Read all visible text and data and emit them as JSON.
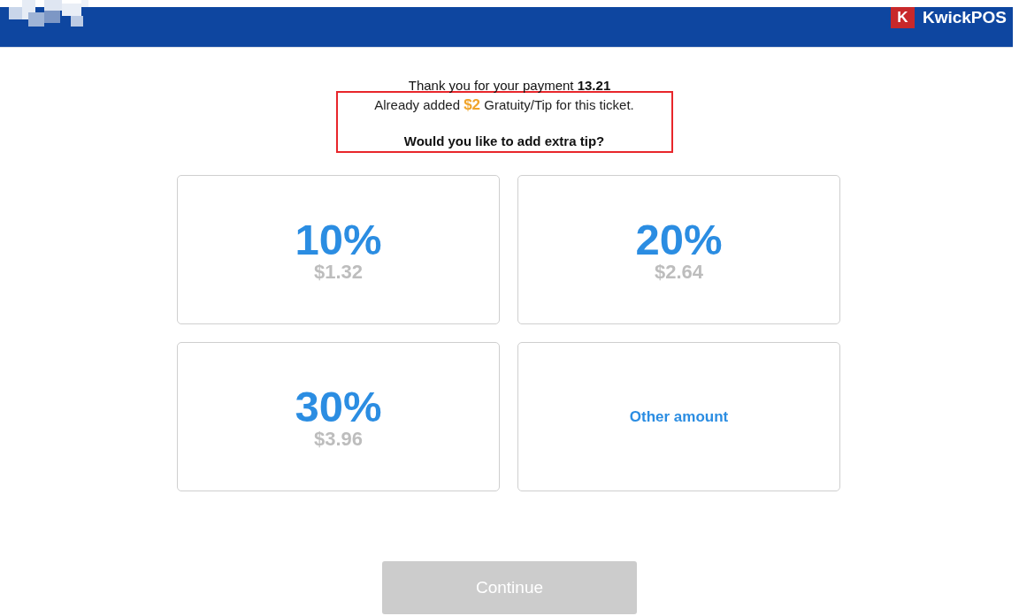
{
  "header": {
    "logo_mark": "K",
    "brand": "KwickPOS"
  },
  "message": {
    "payment_line": "Thank you for your payment **13.21**",
    "highlighted": true,
    "gratuity_line": "Already added **$2** Gratuity/Tip for this ticket.",
    "question": "Would you like to add extra tip?"
  },
  "tip_options": [
    {
      "kind": "percent",
      "percent": "10%",
      "amount": "$1.32"
    },
    {
      "kind": "percent",
      "percent": "20%",
      "amount": "$2.64"
    },
    {
      "kind": "percent",
      "percent": "30%",
      "amount": "$3.96"
    },
    {
      "kind": "custom",
      "label": "Other amount"
    }
  ],
  "continue_button": {
    "label": "Continue",
    "disabled": true
  }
}
